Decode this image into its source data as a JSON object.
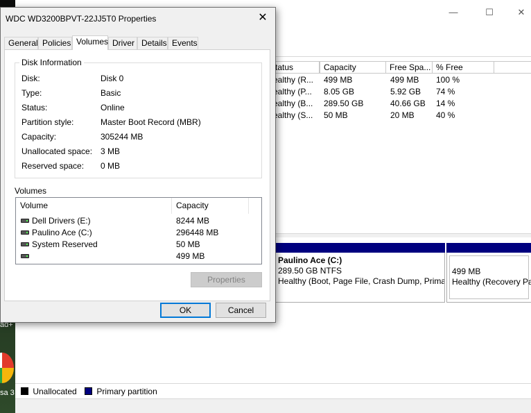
{
  "dialog": {
    "title": "WDC WD3200BPVT-22JJ5T0 Properties",
    "close_glyph": "✕",
    "tabs": [
      {
        "label": "General"
      },
      {
        "label": "Policies"
      },
      {
        "label": "Volumes",
        "active": true
      },
      {
        "label": "Driver"
      },
      {
        "label": "Details"
      },
      {
        "label": "Events"
      }
    ],
    "disk_info": {
      "group_label": "Disk Information",
      "rows": [
        {
          "label": "Disk:",
          "value": "Disk 0"
        },
        {
          "label": "Type:",
          "value": "Basic"
        },
        {
          "label": "Status:",
          "value": "Online"
        },
        {
          "label": "Partition style:",
          "value": "Master Boot Record (MBR)"
        },
        {
          "label": "Capacity:",
          "value": "305244 MB"
        },
        {
          "label": "Unallocated space:",
          "value": "3 MB"
        },
        {
          "label": "Reserved space:",
          "value": "0 MB"
        }
      ]
    },
    "volumes": {
      "section_label": "Volumes",
      "columns": [
        "Volume",
        "Capacity"
      ],
      "rows": [
        {
          "volume": "Dell Drivers (E:)",
          "capacity": "8244 MB"
        },
        {
          "volume": "Paulino Ace (C:)",
          "capacity": "296448 MB"
        },
        {
          "volume": "System Reserved",
          "capacity": "50 MB"
        },
        {
          "volume": "",
          "capacity": "499 MB"
        }
      ],
      "properties_label": "Properties"
    },
    "ok_label": "OK",
    "cancel_label": "Cancel"
  },
  "disk_mgmt": {
    "window_buttons": {
      "minimize": "—",
      "maximize": "☐",
      "close": "✕"
    },
    "columns": [
      "tatus",
      "Capacity",
      "Free Spa...",
      "% Free"
    ],
    "rows": [
      {
        "status": "ealthy (R...",
        "capacity": "499 MB",
        "free": "499 MB",
        "pct": "100 %"
      },
      {
        "status": "ealthy (P...",
        "capacity": "8.05 GB",
        "free": "5.92 GB",
        "pct": "74 %"
      },
      {
        "status": "ealthy (B...",
        "capacity": "289.50 GB",
        "free": "40.66 GB",
        "pct": "14 %"
      },
      {
        "status": "ealthy (S...",
        "capacity": "50 MB",
        "free": "20 MB",
        "pct": "40 %"
      }
    ],
    "partitions": [
      {
        "name": "Paulino Ace  (C:)",
        "size": "289.50 GB NTFS",
        "status": "Healthy (Boot, Page File, Crash Dump, Primar"
      },
      {
        "name": "",
        "size": "499 MB",
        "status": "Healthy (Recovery Pa"
      }
    ],
    "legend": [
      {
        "label": "Unallocated",
        "color": "#000000"
      },
      {
        "label": "Primary partition",
        "color": "#00007f"
      }
    ]
  },
  "desktop": {
    "text1": "ad+",
    "text2": "sa 3"
  }
}
